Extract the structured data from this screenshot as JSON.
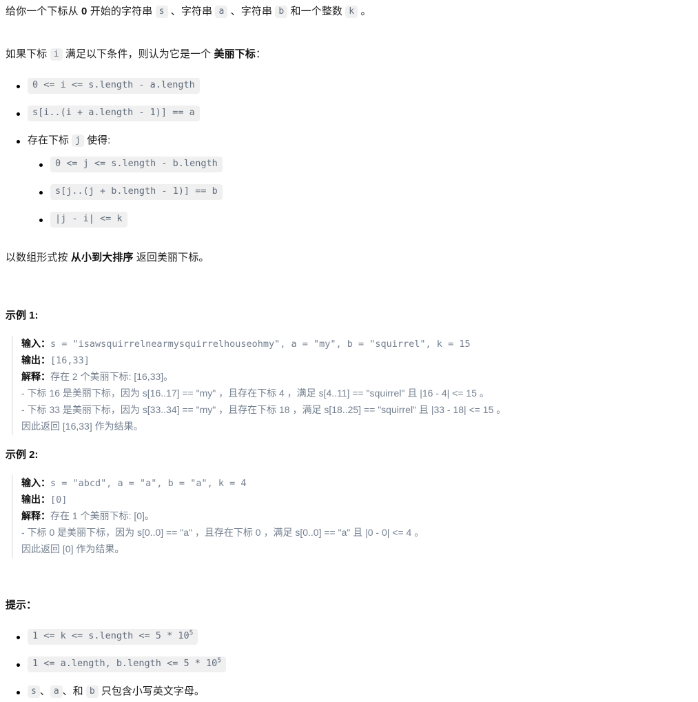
{
  "document": {
    "intro": {
      "p1_before": "给你一个下标从 ",
      "p1_zero": "0",
      "p1_mid1": " 开始的字符串 ",
      "p1_code_s": "s",
      "p1_mid2": " 、字符串 ",
      "p1_code_a": "a",
      "p1_mid3": " 、字符串 ",
      "p1_code_b": "b",
      "p1_mid4": " 和一个整数 ",
      "p1_code_k": "k",
      "p1_end": " 。",
      "p2_before": "如果下标 ",
      "p2_code_i": "i",
      "p2_mid": " 满足以下条件，则认为它是一个 ",
      "p2_bold": "美丽下标",
      "p2_end": "："
    },
    "conditions": {
      "item1": "0 <= i <= s.length - a.length",
      "item2": "s[i..(i + a.length - 1)] == a",
      "item3_text_before": "存在下标 ",
      "item3_code_j": "j",
      "item3_text_after": " 使得:",
      "sub1": "0 <= j <= s.length - b.length",
      "sub2": "s[j..(j + b.length - 1)] == b",
      "sub3": "|j - i| <= k"
    },
    "return_note": {
      "before": "以数组形式按 ",
      "bold": "从小到大排序",
      "after": " 返回美丽下标。"
    },
    "examples": [
      {
        "title": "示例 1:",
        "input_label": "输入：",
        "input_value": "s = \"isawsquirrelnearmysquirrelhouseohmy\", a = \"my\", b = \"squirrel\", k = 15",
        "output_label": "输出：",
        "output_value": "[16,33]",
        "explain_label": "解释：",
        "explain_value": "存在 2 个美丽下标: [16,33]。",
        "detail_lines": [
          "- 下标 16 是美丽下标，因为 s[16..17] == \"my\" ，且存在下标 4 ，满足 s[4..11] == \"squirrel\" 且 |16 - 4| <= 15 。",
          "- 下标 33 是美丽下标，因为 s[33..34] == \"my\" ，且存在下标 18 ，满足 s[18..25] == \"squirrel\" 且 |33 - 18| <= 15 。",
          "因此返回 [16,33] 作为结果。"
        ]
      },
      {
        "title": "示例 2:",
        "input_label": "输入：",
        "input_value": "s = \"abcd\", a = \"a\", b = \"a\", k = 4",
        "output_label": "输出：",
        "output_value": "[0]",
        "explain_label": "解释：",
        "explain_value": "存在 1 个美丽下标: [0]。",
        "detail_lines": [
          "- 下标 0 是美丽下标，因为 s[0..0] == \"a\" ，且存在下标 0 ，满足 s[0..0] == \"a\" 且 |0 - 0| <= 4 。",
          "因此返回 [0] 作为结果。"
        ]
      }
    ],
    "hints": {
      "title": "提示：",
      "item1_pre": "1 <= k <= s.length <= 5 * 10",
      "item1_sup": "5",
      "item2_pre": "1 <= a.length, b.length <= 5 * 10",
      "item2_sup": "5",
      "item3_code_s": "s",
      "item3_sep1": "、",
      "item3_code_a": "a",
      "item3_sep2": "、和 ",
      "item3_code_b": "b",
      "item3_text": " 只包含小写英文字母。"
    }
  },
  "colors": {
    "chip_background": "#f0f0f0",
    "chip_text": "#5f6b7a",
    "code_text": "#737f8f",
    "body_text": "#1f1f1f",
    "quote_border": "#ececec"
  }
}
